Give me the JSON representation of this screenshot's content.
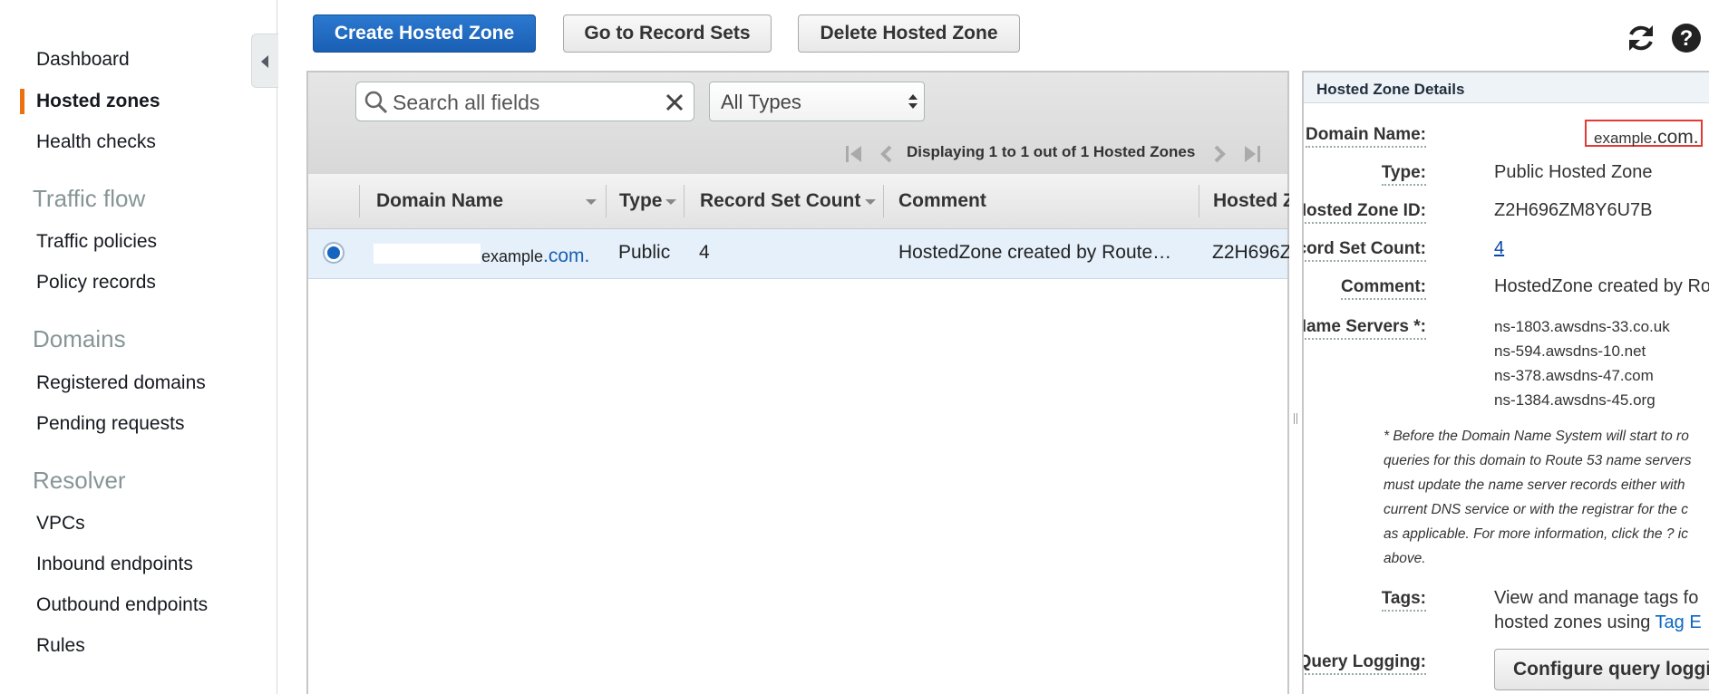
{
  "sidebar": {
    "items": [
      {
        "label": "Dashboard"
      },
      {
        "label": "Hosted zones"
      },
      {
        "label": "Health checks"
      },
      {
        "label": "Traffic policies"
      },
      {
        "label": "Policy records"
      },
      {
        "label": "Registered domains"
      },
      {
        "label": "Pending requests"
      },
      {
        "label": "VPCs"
      },
      {
        "label": "Inbound endpoints"
      },
      {
        "label": "Outbound endpoints"
      },
      {
        "label": "Rules"
      }
    ],
    "sections": [
      {
        "label": "Traffic flow"
      },
      {
        "label": "Domains"
      },
      {
        "label": "Resolver"
      }
    ],
    "active_item": "Hosted zones",
    "accent_color": "#ec7211"
  },
  "toolbar": {
    "create_label": "Create Hosted Zone",
    "goto_label": "Go to Record Sets",
    "delete_label": "Delete Hosted Zone",
    "icons": [
      "refresh-icon",
      "help-icon"
    ]
  },
  "grid": {
    "search_placeholder": "Search all fields",
    "type_filter": "All Types",
    "pager_text": "Displaying 1 to 1 out of 1 Hosted Zones",
    "columns": [
      "Domain Name",
      "Type",
      "Record Set Count",
      "Comment",
      "Hosted Z"
    ],
    "rows": [
      {
        "domain_main": "example",
        "domain_tld": ".com.",
        "type": "Public",
        "count": "4",
        "comment": "HostedZone created by Route…",
        "id": "Z2H696Z"
      }
    ]
  },
  "details": {
    "title": "Hosted Zone Details",
    "labels": {
      "domain": "Domain Name:",
      "type": "Type:",
      "zone_id": "Hosted Zone ID:",
      "count": "Record Set Count:",
      "comment": "Comment:",
      "ns": "Name Servers *:",
      "tags": "Tags:",
      "logging": "Query Logging:"
    },
    "domain_main": "example",
    "domain_tld": ".com.",
    "type": "Public Hosted Zone",
    "zone_id": "Z2H696ZM8Y6U7B",
    "count": "4",
    "comment": "HostedZone created by Rou",
    "name_servers": [
      "ns-1803.awsdns-33.co.uk",
      "ns-594.awsdns-10.net",
      "ns-378.awsdns-47.com",
      "ns-1384.awsdns-45.org"
    ],
    "note_lines": [
      "* Before the Domain Name System will start to ro",
      "queries for this domain to Route 53 name servers",
      "must update the name server records either with",
      "current DNS service or with the registrar for the c",
      "as applicable. For more information, click the ? ic",
      "above."
    ],
    "tags_line1": "View and manage tags fo",
    "tags_line2": "hosted zones using",
    "tags_link": "Tag E",
    "logging_button": "Configure query loggi"
  }
}
